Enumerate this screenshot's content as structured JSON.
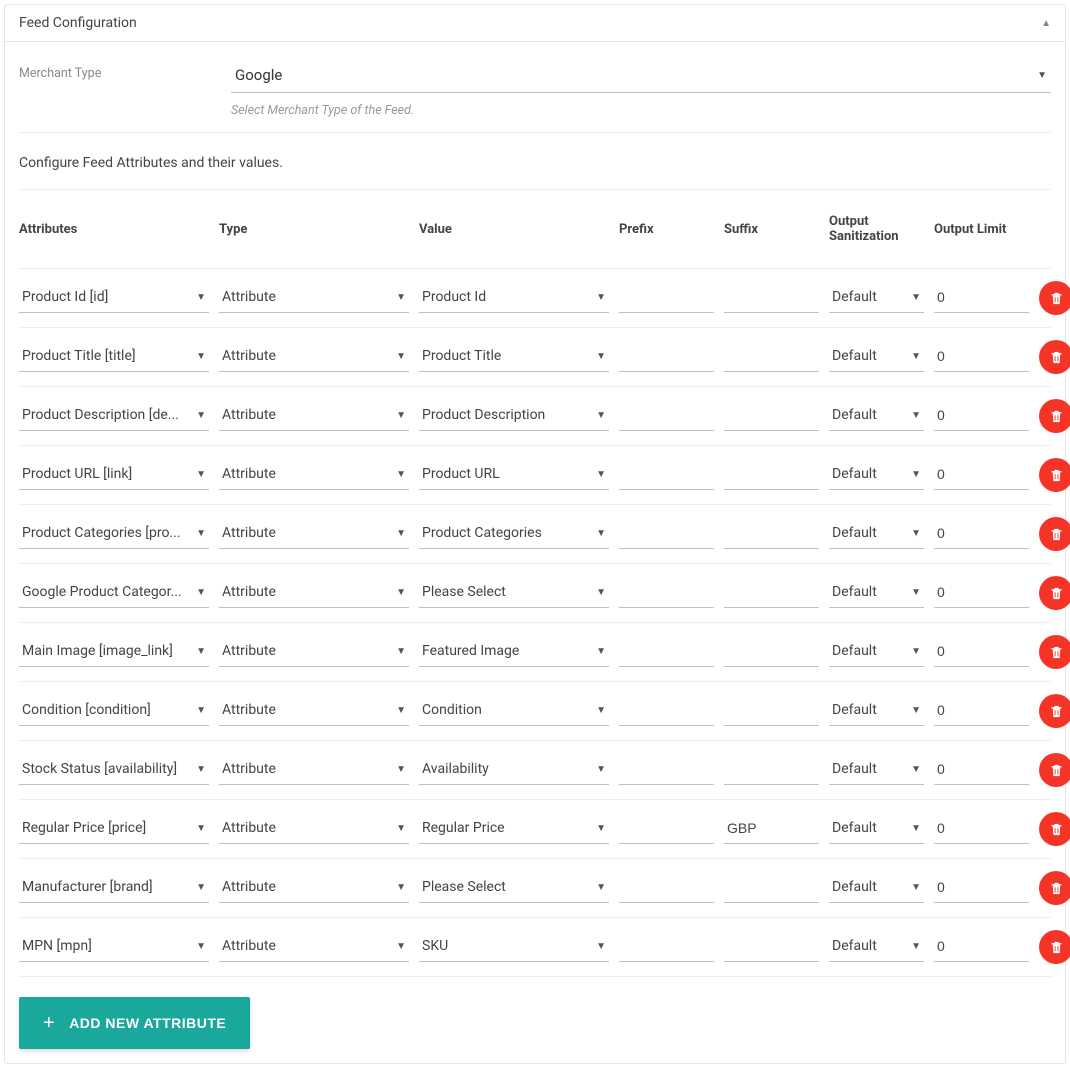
{
  "panel": {
    "title": "Feed Configuration"
  },
  "merchant": {
    "label": "Merchant Type",
    "value": "Google",
    "helper": "Select Merchant Type of the Feed."
  },
  "instructions": "Configure Feed Attributes and their values.",
  "columns": {
    "attributes": "Attributes",
    "type": "Type",
    "value": "Value",
    "prefix": "Prefix",
    "suffix": "Suffix",
    "output_sanitization": "Output Sanitization",
    "output_limit": "Output Limit"
  },
  "rows": [
    {
      "attribute": "Product Id [id]",
      "type": "Attribute",
      "value": "Product Id",
      "prefix": "",
      "suffix": "",
      "sanitization": "Default",
      "limit": "0"
    },
    {
      "attribute": "Product Title [title]",
      "type": "Attribute",
      "value": "Product Title",
      "prefix": "",
      "suffix": "",
      "sanitization": "Default",
      "limit": "0"
    },
    {
      "attribute": "Product Description [de...",
      "type": "Attribute",
      "value": "Product Description",
      "prefix": "",
      "suffix": "",
      "sanitization": "Default",
      "limit": "0"
    },
    {
      "attribute": "Product URL [link]",
      "type": "Attribute",
      "value": "Product URL",
      "prefix": "",
      "suffix": "",
      "sanitization": "Default",
      "limit": "0"
    },
    {
      "attribute": "Product Categories [pro...",
      "type": "Attribute",
      "value": "Product Categories",
      "prefix": "",
      "suffix": "",
      "sanitization": "Default",
      "limit": "0"
    },
    {
      "attribute": "Google Product Categor...",
      "type": "Attribute",
      "value": "Please Select",
      "prefix": "",
      "suffix": "",
      "sanitization": "Default",
      "limit": "0"
    },
    {
      "attribute": "Main Image [image_link]",
      "type": "Attribute",
      "value": "Featured Image",
      "prefix": "",
      "suffix": "",
      "sanitization": "Default",
      "limit": "0"
    },
    {
      "attribute": "Condition [condition]",
      "type": "Attribute",
      "value": "Condition",
      "prefix": "",
      "suffix": "",
      "sanitization": "Default",
      "limit": "0"
    },
    {
      "attribute": "Stock Status [availability]",
      "type": "Attribute",
      "value": "Availability",
      "prefix": "",
      "suffix": "",
      "sanitization": "Default",
      "limit": "0"
    },
    {
      "attribute": "Regular Price [price]",
      "type": "Attribute",
      "value": "Regular Price",
      "prefix": "",
      "suffix": "GBP",
      "sanitization": "Default",
      "limit": "0"
    },
    {
      "attribute": "Manufacturer [brand]",
      "type": "Attribute",
      "value": "Please Select",
      "prefix": "",
      "suffix": "",
      "sanitization": "Default",
      "limit": "0"
    },
    {
      "attribute": "MPN [mpn]",
      "type": "Attribute",
      "value": "SKU",
      "prefix": "",
      "suffix": "",
      "sanitization": "Default",
      "limit": "0"
    }
  ],
  "addButton": "ADD NEW ATTRIBUTE"
}
